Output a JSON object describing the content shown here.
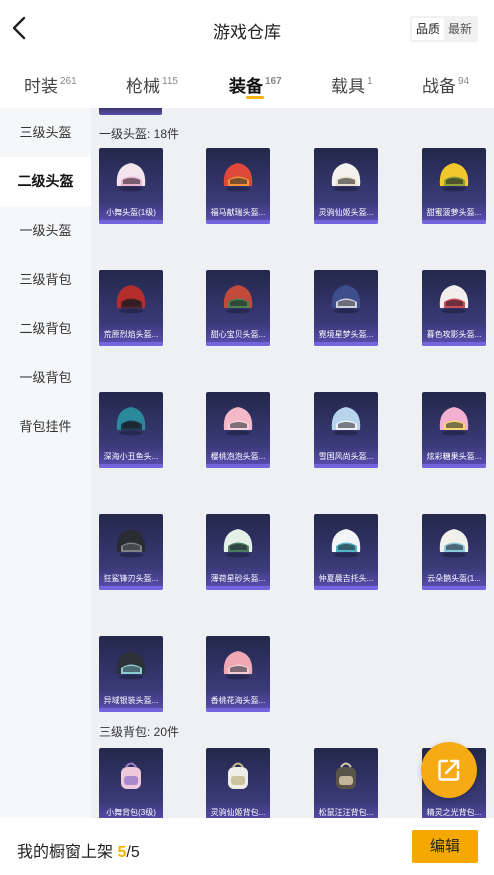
{
  "header": {
    "title": "游戏仓库",
    "sort": [
      "品质",
      "最新"
    ]
  },
  "tabs": [
    {
      "label": "时装",
      "count": "261"
    },
    {
      "label": "枪械",
      "count": "115"
    },
    {
      "label": "装备",
      "count": "167"
    },
    {
      "label": "载具",
      "count": "1"
    },
    {
      "label": "战备",
      "count": "94"
    }
  ],
  "sidebar": {
    "items": [
      "三级头盔",
      "二级头盔",
      "一级头盔",
      "三级背包",
      "二级背包",
      "一级背包",
      "背包挂件"
    ]
  },
  "sections": [
    {
      "title": "一级头盔: 18件",
      "items": [
        {
          "name": "小舞头盔(1级)",
          "color": "#f2e6ec",
          "accent": "#e7a8c8"
        },
        {
          "name": "福马献瑞头盔...",
          "color": "#e0483a",
          "accent": "#f4a03c"
        },
        {
          "name": "灵驹仙姬头盔...",
          "color": "#f4f2ee",
          "accent": "#e8dcc4"
        },
        {
          "name": "甜蜜菠萝头盔...",
          "color": "#f2c72c",
          "accent": "#7c9a3a"
        },
        {
          "name": "荒原烈焰头盔...",
          "color": "#b32e2c",
          "accent": "#3a2022"
        },
        {
          "name": "甜心宝贝头盔...",
          "color": "#c24a3a",
          "accent": "#3a8a5a"
        },
        {
          "name": "霓境星梦头盔...",
          "color": "#3e4e8c",
          "accent": "#e8e8f0"
        },
        {
          "name": "暮色攻影头盔...",
          "color": "#f2eeee",
          "accent": "#c83040"
        },
        {
          "name": "深海小丑鱼头...",
          "color": "#2a8a9c",
          "accent": "#1c2a3c"
        },
        {
          "name": "樱桃泡泡头盔...",
          "color": "#f4b8c8",
          "accent": "#f7d8e0"
        },
        {
          "name": "雪国风尚头盔...",
          "color": "#b8d4ec",
          "accent": "#f4f6fa"
        },
        {
          "name": "炫彩糖果头盔...",
          "color": "#f4b0d0",
          "accent": "#f8e060"
        },
        {
          "name": "狂鲨锋刃头盔...",
          "color": "#2a2c34",
          "accent": "#8e9098"
        },
        {
          "name": "薄荷星砂头盔...",
          "color": "#e4f0e6",
          "accent": "#2e6a4c"
        },
        {
          "name": "仲夏晨吉托头...",
          "color": "#f2f4f6",
          "accent": "#3aa8b8"
        },
        {
          "name": "云朵鹅头盔(1...",
          "color": "#f2f0ea",
          "accent": "#78c4dc"
        },
        {
          "name": "异域银装头盔...",
          "color": "#2c3038",
          "accent": "#9ce8ec"
        },
        {
          "name": "香桃花海头盔...",
          "color": "#f0a8b4",
          "accent": "#f6d2d8"
        }
      ]
    },
    {
      "title": "三级背包: 20件",
      "items": [
        {
          "name": "小舞背包(3级)",
          "color": "#f0c8dc",
          "accent": "#9c7cc8"
        },
        {
          "name": "灵驹仙姬背包...",
          "color": "#eeeee8",
          "accent": "#c8b890"
        },
        {
          "name": "松鼠汪汪背包...",
          "color": "#5a5448",
          "accent": "#d8c8a8"
        },
        {
          "name": "精灵之光背包...",
          "color": "#c8b8f0",
          "accent": "#f0e8ff"
        }
      ]
    }
  ],
  "bottom": {
    "label": "我的橱窗上架",
    "count": "5",
    "total": "/5",
    "edit": "编辑"
  }
}
